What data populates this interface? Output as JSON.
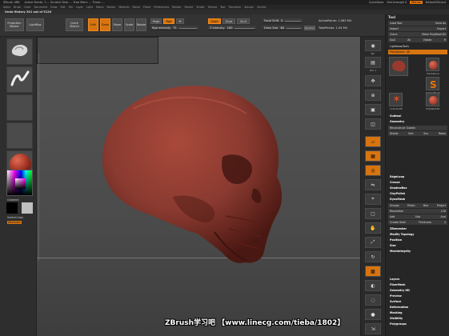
{
  "titlebar": {
    "title": "ZBrush 4R6",
    "stats": "Active Points: 7,... Scratch Disk: ... Free Mem: ... Timer: ...",
    "quicksave": "QuickSave",
    "see_through": "See-through 0",
    "menus": "Menus",
    "default_script": "DefaultZScript"
  },
  "menubar": {
    "items": [
      "Alpha",
      "Brush",
      "Color",
      "Document",
      "Draw",
      "Edit",
      "File",
      "Layer",
      "Light",
      "Macro",
      "Marker",
      "Material",
      "Movie",
      "Picker",
      "Preferences",
      "Render",
      "Stencil",
      "Stroke",
      "Texture",
      "Tool",
      "Transform",
      "Zplugin",
      "Zscript"
    ]
  },
  "notebar": {
    "text": "Undo History 201 out of 5120"
  },
  "topshelf": {
    "projection_master": "Projection Master",
    "lightbox": "LightBox",
    "quick_sketch": "Quick Sketch",
    "edit": "Edit",
    "draw": "Draw",
    "move": "Move",
    "scale": "Scale",
    "rotate": "Rotate",
    "mrgb": "Mrgb",
    "rgb_label": "Rgb",
    "m_label": "M",
    "rgb_intensity_label": "Rgb Intensity",
    "rgb_intensity_value": "71",
    "zadd": "Zadd",
    "zsub": "Zsub",
    "zcut": "Zcut",
    "z_intensity_label": "Z Intensity",
    "z_intensity_value": "100",
    "focal_shift_label": "Focal Shift",
    "focal_shift_value": "0",
    "draw_size_label": "Draw Size",
    "draw_size_value": "64",
    "dynamic": "Dynamic",
    "active_points": "ActivePoints: 1.063 Mil",
    "total_points": "TotalPoints: 1.04 Mil"
  },
  "leftshelf": {
    "gradient_label": "Gradient",
    "switch_color_label": "SwitchColor",
    "alternate_label": "Alternate"
  },
  "rightdock": {
    "items": [
      "Bpr",
      "SPix 3",
      "Scroll",
      "Zoom",
      "Actual",
      "AAHalf",
      "Persp",
      "Floor",
      "Local",
      "LSym",
      "Xyz",
      "Frame",
      "Move",
      "Scale",
      "Rotate",
      "Line Fill",
      "PolyF",
      "Transp",
      "Ghost",
      "Solo",
      "Xpose"
    ]
  },
  "tool_palette": {
    "title": "Tool",
    "load_tool": "Load Tool",
    "save_as": "Save As",
    "import": "Import",
    "export": "Export",
    "clone": "Clone",
    "make_polymesh": "Make PolyMesh3D",
    "goz": "GoZ",
    "all": "All",
    "visible": "Visible",
    "r": "R",
    "lightbox_tools": "Lightbox▸Tools",
    "current_tool": "PolySphere. 48",
    "thumbs": [
      "PolySphere",
      "SimpleBrush",
      "Cylinder3D",
      "PolyMesh3D",
      "PolySphere"
    ],
    "sections": [
      "Subtool",
      "Geometry",
      "Reconstruct Subdiv",
      "Divide",
      "Smt",
      "Suv",
      "Relax",
      "EdgeLoop",
      "Crease",
      "ShadowBox",
      "ClayPolish",
      "DynaMesh",
      "Groups",
      "Polish",
      "Blur",
      "Project",
      "Resolution",
      "Add",
      "Sub",
      "And",
      "Create Shell",
      "Thickness",
      "ZRemesher",
      "Modify Topology",
      "Position",
      "Size",
      "MeshIntegrity",
      "Layers",
      "FiberMesh",
      "Geometry HD",
      "Preview",
      "Surface",
      "Deformation",
      "Masking",
      "Visibility",
      "Polygroups"
    ],
    "resolution_value": "128",
    "thickness_value": "4"
  },
  "watermark": "ZBrush学习吧 【www.linecg.com/tieba/1802】",
  "colors": {
    "accent": "#d8740f",
    "skull": "#8a3a30",
    "canvas": "#4d4d4d"
  }
}
